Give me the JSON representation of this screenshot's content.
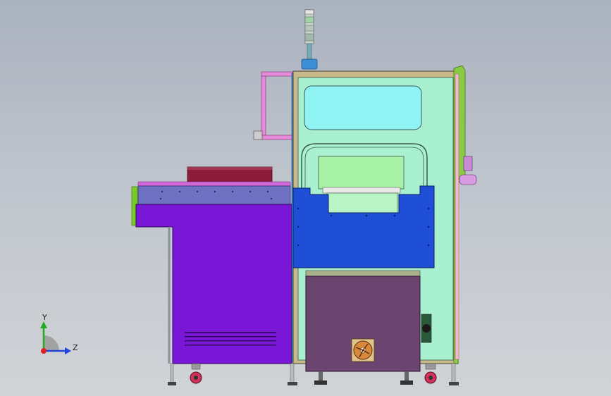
{
  "viewport": {
    "axis_triad": {
      "y_label": "Y",
      "z_label": "Z",
      "y_color": "#22aa22",
      "z_color": "#2244dd",
      "origin_color": "#dd2222"
    }
  },
  "model": {
    "description_colors": {
      "conveyor_body": "#7a17d6",
      "conveyor_top_rail": "#6666bb",
      "conveyor_cover": "#8a1b3a",
      "main_frame": "#c8b98a",
      "main_panel": "#a8f0d0",
      "window": "#90f4f4",
      "lower_blue_block": "#1f4fd6",
      "cabinet": "#6b4570",
      "side_green": "#77cc22",
      "signal_tower": "#88ccaa"
    }
  }
}
